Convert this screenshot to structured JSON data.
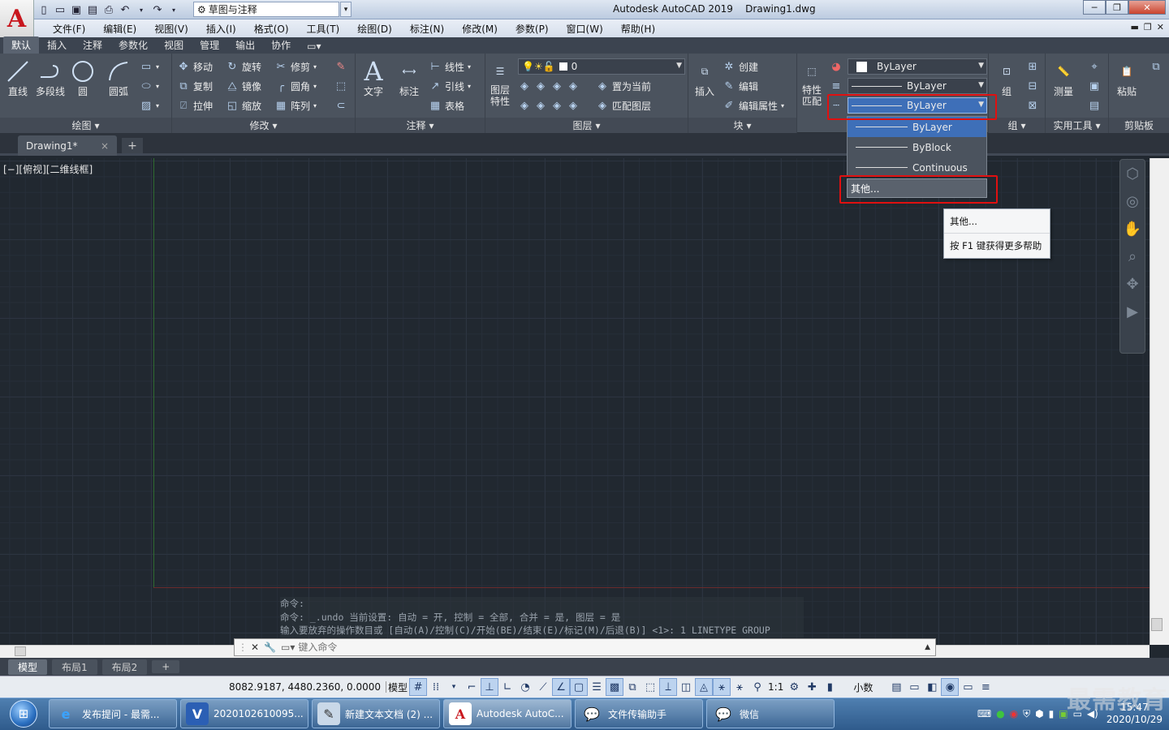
{
  "title_bar": {
    "app_title": "Autodesk AutoCAD 2019    Drawing1.dwg",
    "workspace": "草图与注释",
    "minimize": "─",
    "restore": "❐",
    "close": "✕"
  },
  "menu_bar": {
    "items": [
      "文件(F)",
      "编辑(E)",
      "视图(V)",
      "插入(I)",
      "格式(O)",
      "工具(T)",
      "绘图(D)",
      "标注(N)",
      "修改(M)",
      "参数(P)",
      "窗口(W)",
      "帮助(H)"
    ]
  },
  "ribbon_tabs": [
    "默认",
    "插入",
    "注释",
    "参数化",
    "视图",
    "管理",
    "输出",
    "协作"
  ],
  "ribbon": {
    "draw": {
      "title": "绘图",
      "line": "直线",
      "polyline": "多段线",
      "circle": "圆",
      "arc": "圆弧"
    },
    "modify": {
      "title": "修改",
      "move": "移动",
      "rotate": "旋转",
      "trim": "修剪",
      "copy": "复制",
      "mirror": "镜像",
      "fillet": "圆角",
      "stretch": "拉伸",
      "scale": "缩放",
      "array": "阵列"
    },
    "annotation": {
      "title": "注释",
      "text": "文字",
      "dimension": "标注",
      "linear": "线性",
      "leader": "引线",
      "table": "表格"
    },
    "layers": {
      "title": "图层",
      "layer_props": "图层\n特性",
      "layer_name": "0",
      "set_current": "置为当前",
      "match_layer": "匹配图层"
    },
    "block": {
      "title": "块",
      "insert": "插入",
      "create": "创建",
      "edit": "编辑",
      "edit_attr": "编辑属性"
    },
    "properties": {
      "match": "特性\n匹配",
      "color": "ByLayer",
      "lineweight": "ByLayer",
      "linetype": "ByLayer"
    },
    "group": {
      "title": "组",
      "group": "组"
    },
    "utilities": {
      "title": "实用工具",
      "measure": "测量"
    },
    "clipboard": {
      "title": "剪贴板",
      "paste": "粘贴"
    }
  },
  "document": {
    "tab": "Drawing1*",
    "close": "×",
    "new_tab": "+"
  },
  "viewport": {
    "label": "[−][俯视][二维线框]"
  },
  "linetype_dropdown": {
    "options": [
      "ByLayer",
      "ByBlock",
      "Continuous"
    ],
    "selected": "ByLayer",
    "other": "其他..."
  },
  "tooltip_menu": {
    "items": [
      "其他...",
      "按 F1 键获得更多帮助"
    ]
  },
  "command": {
    "history": [
      "命令:",
      "命令: _.undo 当前设置: 自动 = 开, 控制 = 全部, 合并 = 是, 图层 = 是",
      "输入要放弃的操作数目或 [自动(A)/控制(C)/开始(BE)/结束(E)/标记(M)/后退(B)] <1>: 1 LINETYPE GROUP"
    ],
    "placeholder": "键入命令"
  },
  "layout_tabs": [
    "模型",
    "布局1",
    "布局2"
  ],
  "status_bar": {
    "coordinates": "8082.9187, 4480.2360, 0.0000",
    "model": "模型",
    "scale": "1:1",
    "units": "小数"
  },
  "taskbar": {
    "tasks": [
      "发布提问 - 最需...",
      "2020102610095...",
      "新建文本文档 (2) ...",
      "Autodesk AutoC...",
      "文件传输助手",
      "微信"
    ],
    "time": "15:47",
    "date": "2020/10/29"
  },
  "watermark": "最需教育",
  "colors": {
    "accent": "#3e6fb8",
    "highlight_box": "#e01010",
    "canvas": "#212830"
  }
}
